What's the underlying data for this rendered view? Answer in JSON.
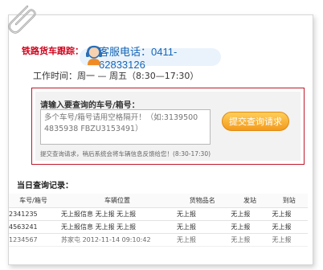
{
  "header": {
    "title": "铁路货车跟踪：",
    "service_phone": "客服电话：0411-62833126",
    "hours": "工作时间：周一 — 周五（8:30—17:30）"
  },
  "query": {
    "label": "请输入要查询的车号/箱号：",
    "placeholder": "多个车号/箱号请用空格隔开！（如:3139500 4835938 FBZU3153491）",
    "submit_label": "提交查询请求",
    "hint": "提交查询请求，稍后系统会将车辆信息反馈给您！(8:30-17:30)"
  },
  "records": {
    "title": "当日查询记录：",
    "columns": [
      "车号/箱号",
      "车辆位置",
      "货物品名",
      "发站",
      "到站"
    ],
    "rows": [
      [
        "2341235",
        "无上报信息 无上报 无上报",
        "无上报",
        "无上报",
        "无上报"
      ],
      [
        "4563241",
        "无上报信息 无上报 无上报",
        "无上报",
        "无上报",
        "无上报"
      ],
      [
        "1234567",
        "苏家屯 2012-11-14 09:10:42",
        "无上报",
        "无上报",
        "无上报"
      ]
    ]
  },
  "colors": {
    "accent_red": "#d0021b",
    "phone_blue": "#1566b7",
    "button_orange": "#f39a1c"
  },
  "icons": [
    "paperclip-icon",
    "customer-service-icon"
  ]
}
